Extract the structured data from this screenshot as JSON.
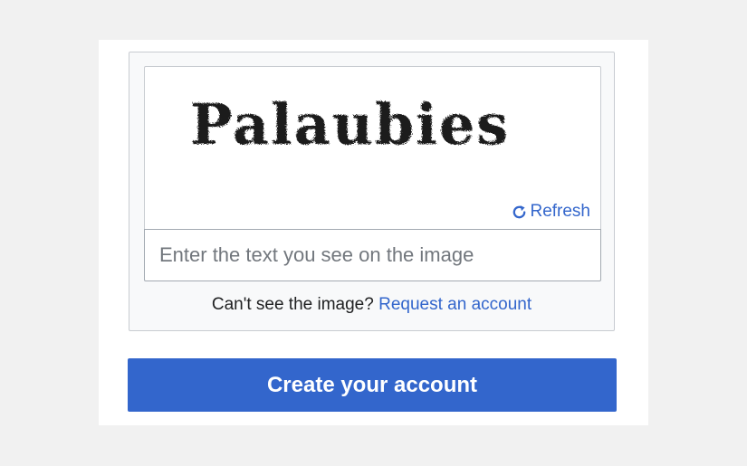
{
  "captcha": {
    "image_text": "Palaubies",
    "refresh_label": "Refresh",
    "refresh_icon": "refresh-icon",
    "input_placeholder": "Enter the text you see on the image",
    "input_value": ""
  },
  "help": {
    "prompt": "Can't see the image?",
    "link_label": "Request an account"
  },
  "form": {
    "submit_label": "Create your account"
  },
  "colors": {
    "link": "#3366cc",
    "button_bg": "#3366cc",
    "page_bg": "#f1f1f1",
    "box_bg": "#f8f9fa"
  }
}
